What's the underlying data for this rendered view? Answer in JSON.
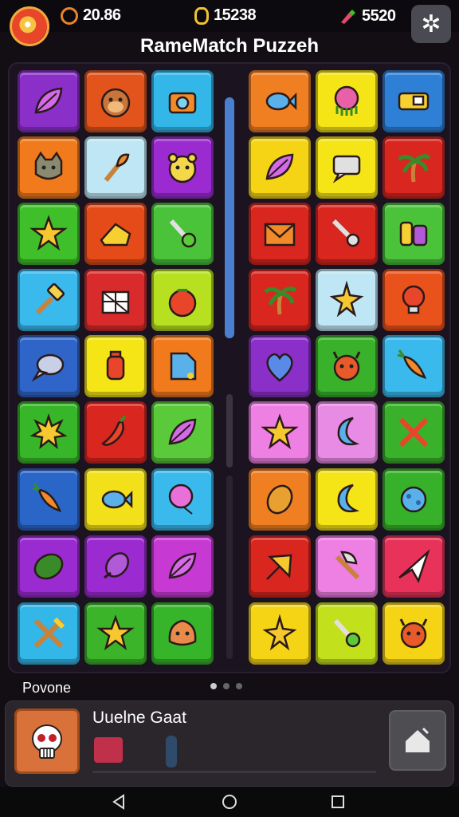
{
  "header": {
    "title": "RameMatch Puzzeh",
    "stats": [
      {
        "icon": "clock-icon",
        "value": "20.86",
        "color": "#e8842a"
      },
      {
        "icon": "coin-icon",
        "value": "15238",
        "color": "#f2c230"
      },
      {
        "icon": "gem-icon",
        "value": "5520",
        "color": "#e04a6a"
      }
    ],
    "settings_icon": "gear-icon"
  },
  "board": {
    "left_grid": [
      [
        {
          "color": "#8b2fc9",
          "icon": "leaf-icon"
        },
        {
          "color": "#e2541c",
          "icon": "monkey-face-icon"
        },
        {
          "color": "#33b6e8",
          "icon": "camera-icon"
        }
      ],
      [
        {
          "color": "#f07a1c",
          "icon": "cat-face-icon"
        },
        {
          "color": "#bfe6f5",
          "icon": "torch-icon"
        },
        {
          "color": "#9b2bd1",
          "icon": "bear-face-icon"
        }
      ],
      [
        {
          "color": "#3fbf2a",
          "icon": "star-icon"
        },
        {
          "color": "#e44b18",
          "icon": "cheese-icon"
        },
        {
          "color": "#4ac23a",
          "icon": "spoon-icon"
        }
      ],
      [
        {
          "color": "#3ab9ec",
          "icon": "hammer-icon"
        },
        {
          "color": "#d92b2b",
          "icon": "gift-box-icon"
        },
        {
          "color": "#b7e021",
          "icon": "tomato-icon"
        }
      ],
      [
        {
          "color": "#2f64c9",
          "icon": "speech-bubble-icon"
        },
        {
          "color": "#f5e416",
          "icon": "lantern-icon"
        },
        {
          "color": "#f07a1c",
          "icon": "flag-icon"
        }
      ],
      [
        {
          "color": "#38b62a",
          "icon": "burst-icon"
        },
        {
          "color": "#d9261f",
          "icon": "pepper-icon"
        },
        {
          "color": "#5ac93a",
          "icon": "leaf-icon"
        }
      ],
      [
        {
          "color": "#2a66c7",
          "icon": "carrot-icon"
        },
        {
          "color": "#f2e11a",
          "icon": "fish-icon"
        },
        {
          "color": "#3ab9ec",
          "icon": "balloon-icon"
        }
      ],
      [
        {
          "color": "#9a2bd0",
          "icon": "watermelon-icon"
        },
        {
          "color": "#9b2bd1",
          "icon": "rocket-icon"
        },
        {
          "color": "#c63ad3",
          "icon": "leaf-icon"
        }
      ],
      [
        {
          "color": "#33b6e8",
          "icon": "crossed-tools-icon"
        },
        {
          "color": "#3cb42a",
          "icon": "star-icon"
        },
        {
          "color": "#37b52a",
          "icon": "blob-face-icon"
        }
      ]
    ],
    "right_grid": [
      [
        {
          "color": "#f07f22",
          "icon": "fish-icon"
        },
        {
          "color": "#f5e416",
          "icon": "octopus-icon"
        },
        {
          "color": "#2e7fd6",
          "icon": "truck-icon"
        }
      ],
      [
        {
          "color": "#f5d416",
          "icon": "leaf-icon"
        },
        {
          "color": "#f5e416",
          "icon": "chat-icon"
        },
        {
          "color": "#d9261f",
          "icon": "palm-tree-icon"
        }
      ],
      [
        {
          "color": "#d9261f",
          "icon": "envelope-icon"
        },
        {
          "color": "#d9261f",
          "icon": "magnifier-icon"
        },
        {
          "color": "#4ac23a",
          "icon": "robot-icon"
        }
      ],
      [
        {
          "color": "#d9261f",
          "icon": "palm-tree-icon"
        },
        {
          "color": "#bfe6f5",
          "icon": "starfish-icon"
        },
        {
          "color": "#e9521b",
          "icon": "bulb-icon"
        }
      ],
      [
        {
          "color": "#8b2fc9",
          "icon": "heart-icon"
        },
        {
          "color": "#39b12a",
          "icon": "monster-face-icon"
        },
        {
          "color": "#3ab9ec",
          "icon": "carrot-icon"
        }
      ],
      [
        {
          "color": "#ee7fe3",
          "icon": "star-icon"
        },
        {
          "color": "#e88be5",
          "icon": "moon-icon"
        },
        {
          "color": "#39b12a",
          "icon": "crossed-swords-icon"
        }
      ],
      [
        {
          "color": "#f07f22",
          "icon": "seed-icon"
        },
        {
          "color": "#f5e416",
          "icon": "moon-icon"
        },
        {
          "color": "#38b12a",
          "icon": "virus-icon"
        }
      ],
      [
        {
          "color": "#d9261f",
          "icon": "arrow-icon"
        },
        {
          "color": "#ee7fe3",
          "icon": "axe-icon"
        },
        {
          "color": "#e8325a",
          "icon": "paper-plane-icon"
        }
      ],
      [
        {
          "color": "#f5d416",
          "icon": "starfish-icon"
        },
        {
          "color": "#c3e01c",
          "icon": "spoon-icon"
        },
        {
          "color": "#f5d416",
          "icon": "monster-face-icon"
        }
      ]
    ]
  },
  "footer": {
    "section_label": "Povone",
    "page_dots": 3,
    "active_dot": 0,
    "panel_title": "Uuelne Gaat",
    "avatar_icon": "skull-icon",
    "home_icon": "home-icon"
  },
  "navbar": {
    "buttons": [
      {
        "icon": "back-icon"
      },
      {
        "icon": "home-circle-icon"
      },
      {
        "icon": "recents-icon"
      }
    ]
  }
}
